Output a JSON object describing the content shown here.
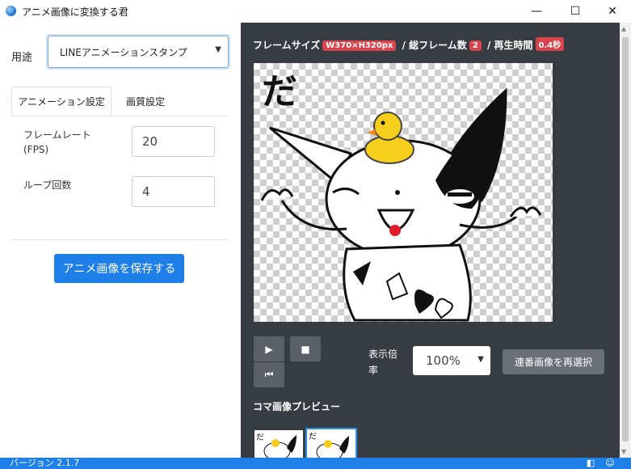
{
  "window": {
    "title": "アニメ画像に変換する君",
    "minimize": "—",
    "maximize": "☐",
    "close": "✕"
  },
  "sidebar": {
    "usage_label": "用途",
    "usage_value": "LINEアニメーションスタンプ",
    "tabs": [
      {
        "label": "アニメーション設定",
        "active": true
      },
      {
        "label": "画質設定",
        "active": false
      }
    ],
    "frame_rate": {
      "label_line1": "フレームレート",
      "label_line2": "(FPS)",
      "value": "20"
    },
    "loop_count": {
      "label": "ループ回数",
      "value": "4"
    },
    "save_button": "アニメ画像を保存する"
  },
  "preview": {
    "frame_size_label": "フレームサイズ",
    "frame_size": "W370×H320px",
    "total_frames_label": "総フレーム数",
    "total_frames": "2",
    "duration_label": "再生時間",
    "duration": "0.4秒",
    "sticker_text": "だ",
    "zoom_label": "表示倍率",
    "zoom_value": "100%",
    "reselect_button": "連番画像を再選択",
    "thumbnails_title": "コマ画像プレビュー",
    "thumbnail_text": "だ"
  },
  "status": {
    "version": "バージョン 2.1.7"
  },
  "colors": {
    "accent": "#1e7fe8",
    "badge": "#d9434c",
    "panel": "#373b42"
  }
}
